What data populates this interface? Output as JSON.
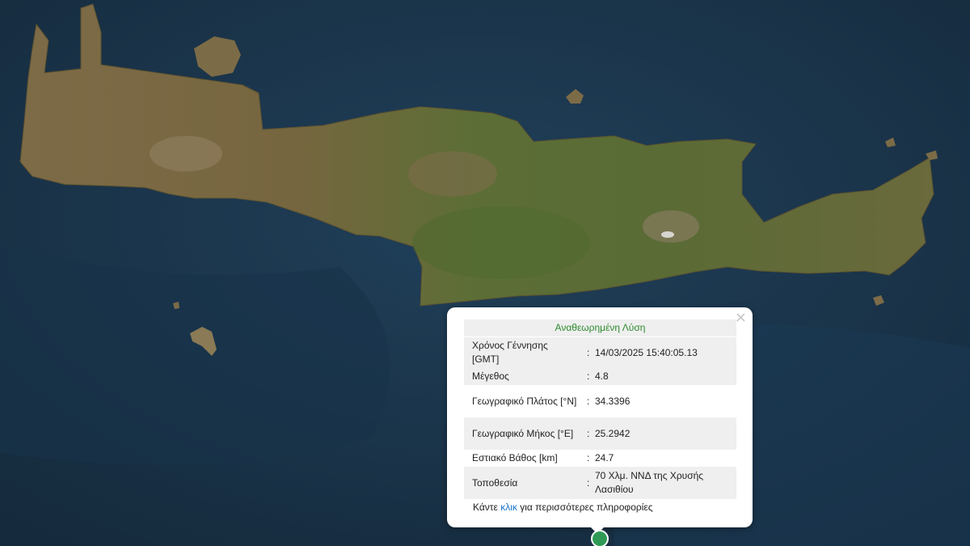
{
  "popup": {
    "title": "Αναθεωρημένη Λύση",
    "close_symbol": "×",
    "rows": [
      {
        "label": "Χρόνος Γέννησης [GMT]",
        "separator": ":",
        "value": "14/03/2025 15:40:05.13"
      },
      {
        "label": "Μέγεθος",
        "separator": ":",
        "value": "4.8"
      },
      {
        "label": "Γεωγραφικό Πλάτος [°N]",
        "separator": ":",
        "value": "34.3396"
      },
      {
        "label": "Γεωγραφικό Μήκος [°E]",
        "separator": ":",
        "value": "25.2942"
      },
      {
        "label": "Εστιακό Βάθος [km]",
        "separator": ":",
        "value": "24.7"
      },
      {
        "label": "Τοποθεσία",
        "separator": ":",
        "value": "70 Χλμ. ΝΝΔ της Χρυσής Λασιθίου"
      }
    ],
    "footer_before": "Κάντε ",
    "footer_link": "κλικ",
    "footer_after": " για περισσότερες πληροφορίες"
  },
  "colors": {
    "sea": "#1b3348",
    "land": "#7a6a45",
    "land_green": "#566d34",
    "title_text": "#2e8b2e",
    "link": "#1a73c9",
    "marker": "#2e9a55"
  },
  "icons": {
    "close": "close-icon",
    "marker": "epicenter-marker-icon"
  }
}
